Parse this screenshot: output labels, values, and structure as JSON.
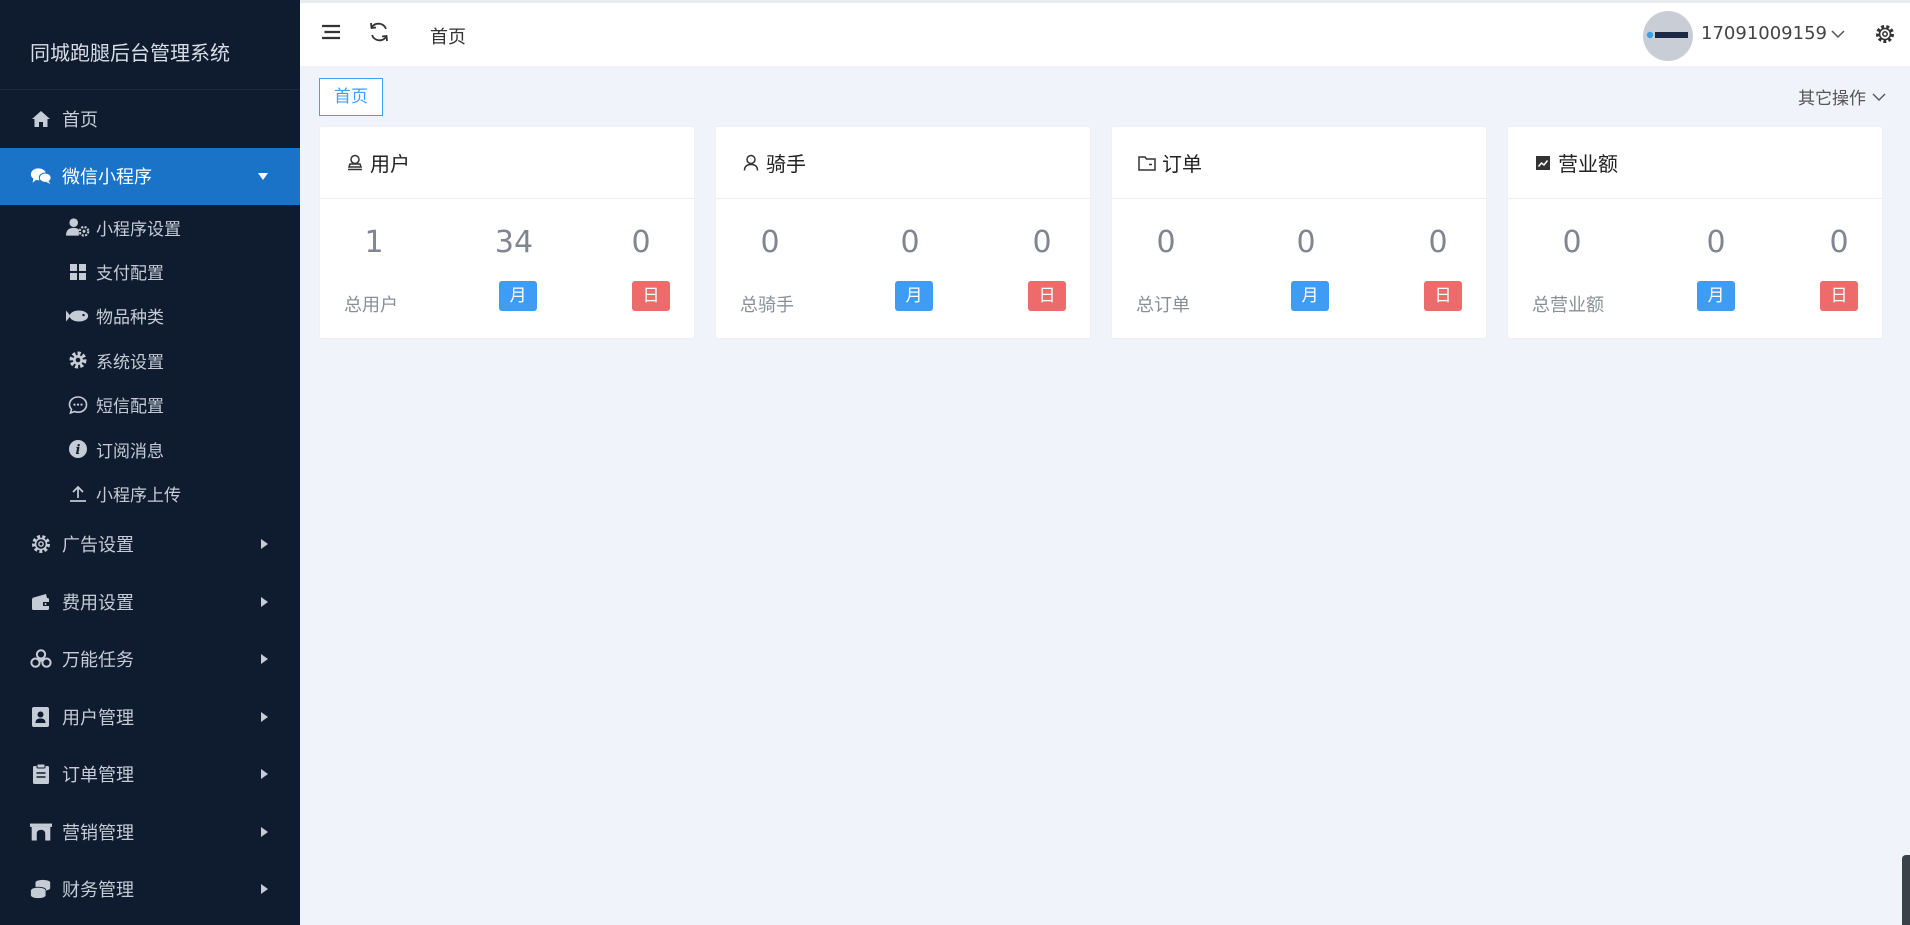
{
  "app": {
    "title": "同城跑腿后台管理系统"
  },
  "sidebar": {
    "items": [
      {
        "label": "首页",
        "icon": "home-icon"
      },
      {
        "label": "微信小程序",
        "icon": "wechat-icon",
        "active": true,
        "expanded": true
      },
      {
        "label": "广告设置",
        "icon": "gear-outline-icon"
      },
      {
        "label": "费用设置",
        "icon": "wallet-icon"
      },
      {
        "label": "万能任务",
        "icon": "biohazard-icon"
      },
      {
        "label": "用户管理",
        "icon": "address-book-icon"
      },
      {
        "label": "订单管理",
        "icon": "clipboard-icon"
      },
      {
        "label": "营销管理",
        "icon": "archway-icon"
      },
      {
        "label": "财务管理",
        "icon": "coins-icon"
      }
    ],
    "sub_items": [
      {
        "label": "小程序设置",
        "icon": "user-gear-icon"
      },
      {
        "label": "支付配置",
        "icon": "grid-icon"
      },
      {
        "label": "物品种类",
        "icon": "fish-icon"
      },
      {
        "label": "系统设置",
        "icon": "cog-icon"
      },
      {
        "label": "短信配置",
        "icon": "chat-bubble-icon"
      },
      {
        "label": "订阅消息",
        "icon": "info-icon"
      },
      {
        "label": "小程序上传",
        "icon": "upload-icon"
      }
    ]
  },
  "topbar": {
    "breadcrumb": "首页",
    "username": "17091009159"
  },
  "tabs": {
    "home_tab": "首页",
    "other_ops": "其它操作"
  },
  "cards": [
    {
      "title": "用户",
      "icon": "user-icon",
      "values": [
        "1",
        "34",
        "0"
      ],
      "label": "总用户",
      "month": "月",
      "day": "日"
    },
    {
      "title": "骑手",
      "icon": "rider-icon",
      "values": [
        "0",
        "0",
        "0"
      ],
      "label": "总骑手",
      "month": "月",
      "day": "日"
    },
    {
      "title": "订单",
      "icon": "folder-icon",
      "values": [
        "0",
        "0",
        "0"
      ],
      "label": "总订单",
      "month": "月",
      "day": "日"
    },
    {
      "title": "营业额",
      "icon": "chart-icon",
      "values": [
        "0",
        "0",
        "0"
      ],
      "label": "总营业额",
      "month": "月",
      "day": "日"
    }
  ],
  "colors": {
    "sidebar_bg": "#0f1c2f",
    "active_bg": "#1a73c7",
    "badge_month": "#3f9cf5",
    "badge_day": "#ee6b6b",
    "content_bg": "#f0f3f9"
  }
}
